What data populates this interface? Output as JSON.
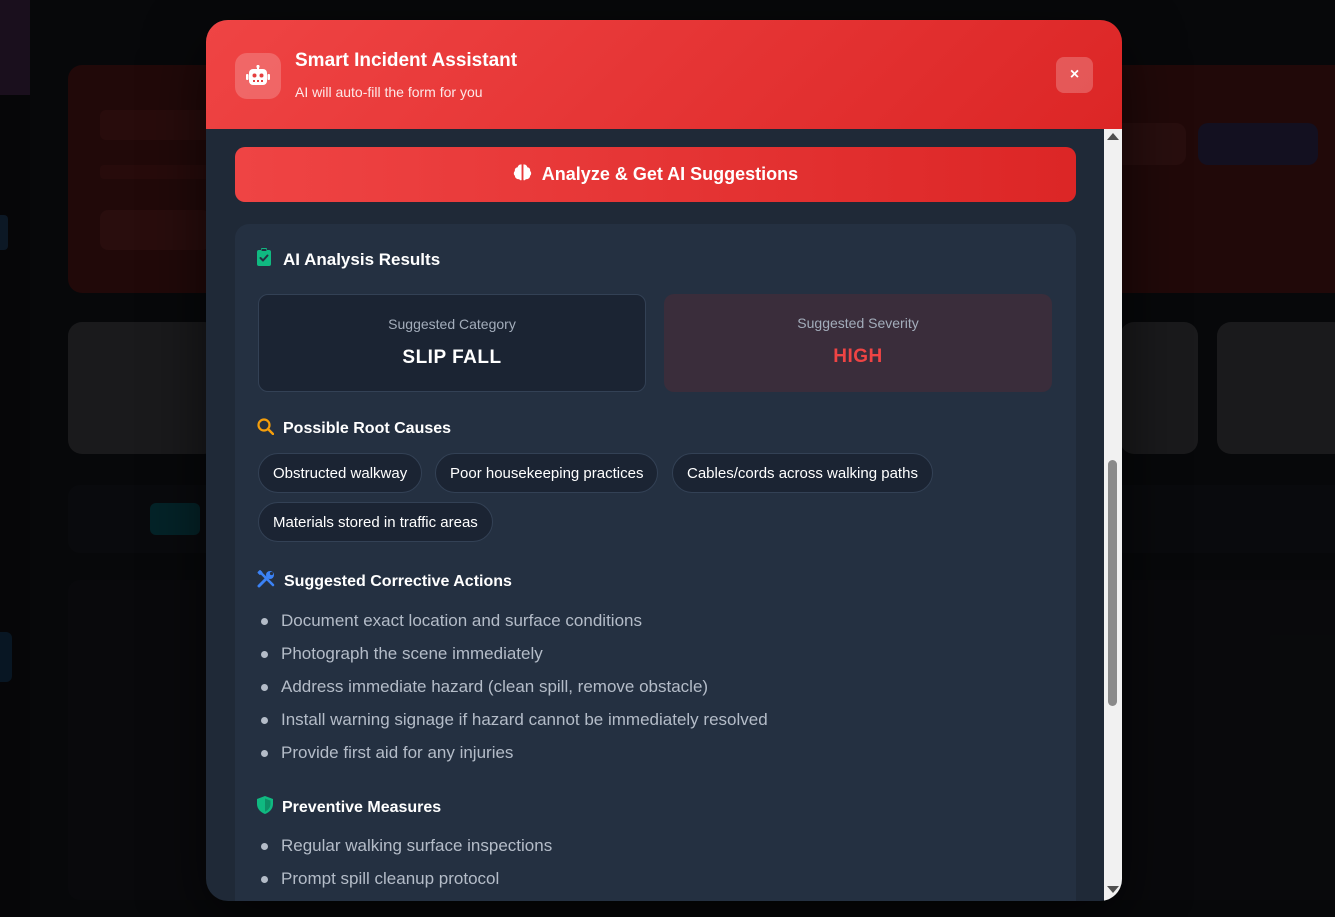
{
  "colors": {
    "accent": "#ef4444",
    "accent_dark": "#dc2626",
    "modal_bg": "#1f2937",
    "card_bg": "#243041",
    "severity_high": "#ef4444",
    "root_cause_icon": "#f59e0b",
    "actions_icon": "#3b82f6",
    "preventive_icon": "#10b981",
    "results_icon": "#10b981"
  },
  "modal": {
    "title": "Smart Incident Assistant",
    "subtitle": "AI will auto-fill the form for you",
    "header_icon": "robot-icon",
    "close_label": "×"
  },
  "analyze_button": {
    "label": "Analyze & Get AI Suggestions",
    "icon": "brain-icon"
  },
  "results": {
    "title": "AI Analysis Results",
    "icon": "clipboard-check-icon",
    "category": {
      "label": "Suggested Category",
      "value": "SLIP FALL"
    },
    "severity": {
      "label": "Suggested Severity",
      "value": "HIGH"
    }
  },
  "root_causes": {
    "title": "Possible Root Causes",
    "icon": "search-icon",
    "items": [
      "Obstructed walkway",
      "Poor housekeeping practices",
      "Cables/cords across walking paths",
      "Materials stored in traffic areas"
    ]
  },
  "corrective_actions": {
    "title": "Suggested Corrective Actions",
    "icon": "tools-icon",
    "items": [
      "Document exact location and surface conditions",
      "Photograph the scene immediately",
      "Address immediate hazard (clean spill, remove obstacle)",
      "Install warning signage if hazard cannot be immediately resolved",
      "Provide first aid for any injuries"
    ]
  },
  "preventive_measures": {
    "title": "Preventive Measures",
    "icon": "shield-icon",
    "items": [
      "Regular walking surface inspections",
      "Prompt spill cleanup protocol"
    ]
  }
}
